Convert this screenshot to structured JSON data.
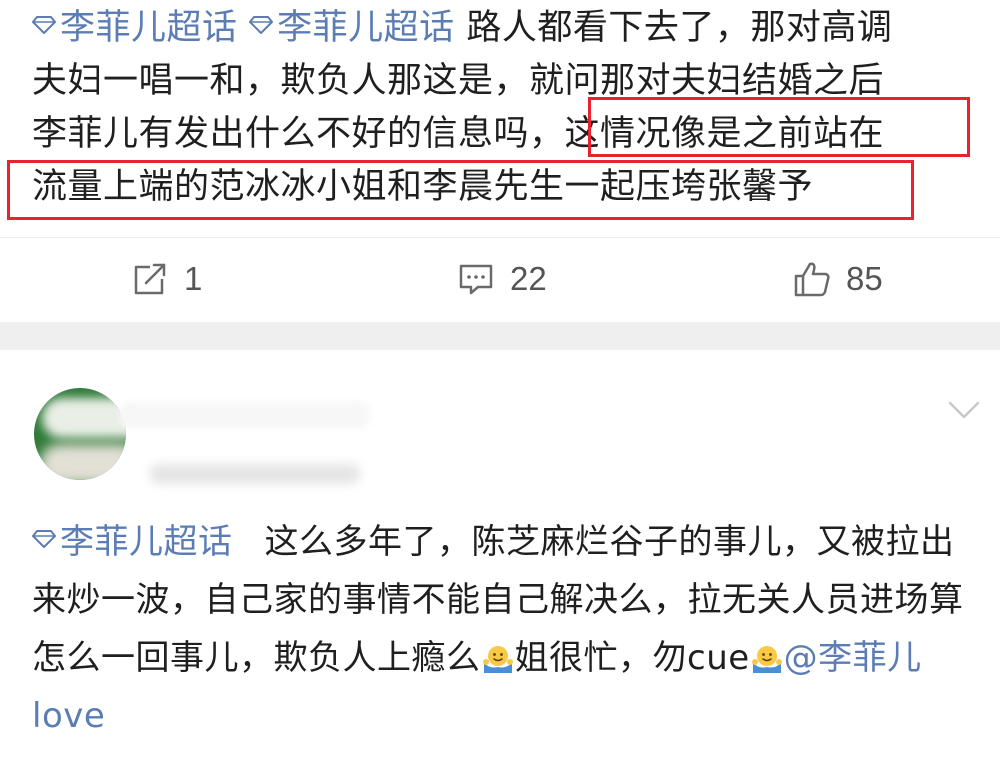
{
  "post1": {
    "topic_tags": [
      "李菲儿超话",
      "李菲儿超话"
    ],
    "text_line1_rest": "路人都看下去了，那对高调",
    "text_line2": "夫妇一唱一和，欺负人那这是，就问那对夫妇结婚之后",
    "text_line3_start": "李菲儿有发出什么不好的信息吗，",
    "text_line3_highlight": "这情况像是之前站在",
    "text_line4_highlight": "流量上端的范冰冰小姐和李晨先生一起压垮张馨予",
    "actions": {
      "repost_count": "1",
      "comment_count": "22",
      "like_count": "85"
    },
    "highlight_color": "#e8232e",
    "topic_color": "#5b7db3"
  },
  "post2": {
    "topic_tag": "李菲儿超话",
    "text_part1": "这么多年了，陈芝麻烂谷子的事儿，又被拉出来炒一波，自己家的事情不能自己解决么，拉无关人员进场算怎么一回事儿，欺负人上瘾么",
    "text_part2": "姐很忙，勿cue",
    "mention": "@李菲儿love",
    "emoji": "shrug-emoji"
  },
  "icons": {
    "repost": "repost-icon",
    "comment": "comment-icon",
    "like": "thumbs-up-icon",
    "more": "chevron-down-icon",
    "topic": "diamond-gem-icon"
  }
}
